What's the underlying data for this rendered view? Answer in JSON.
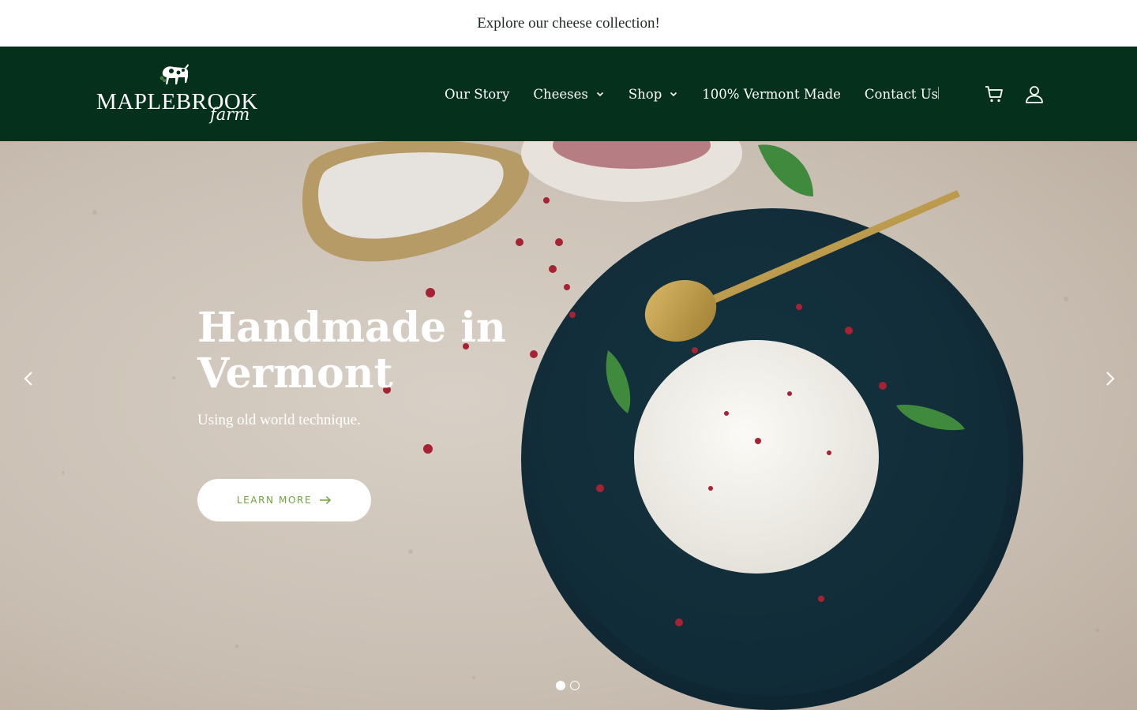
{
  "announcement": {
    "text": "Explore our cheese collection!"
  },
  "header": {
    "logo": {
      "wordmark": "MAPLEBROOK",
      "script": "farm"
    },
    "nav": [
      {
        "label": "Our Story",
        "has_dropdown": false
      },
      {
        "label": "Cheeses",
        "has_dropdown": true
      },
      {
        "label": "Shop",
        "has_dropdown": true
      },
      {
        "label": "100% Vermont Made",
        "has_dropdown": false
      },
      {
        "label": "Contact Us",
        "has_dropdown": false
      }
    ],
    "icons": [
      "cart-icon",
      "account-icon"
    ]
  },
  "hero": {
    "title": "Handmade in Vermont",
    "subtitle": "Using old world technique.",
    "cta_label": "LEARN MORE",
    "slides_total": 2,
    "active_slide": 1
  },
  "colors": {
    "header_bg": "#05311c",
    "cta_text": "#73a13e",
    "background": "#ffffff"
  }
}
